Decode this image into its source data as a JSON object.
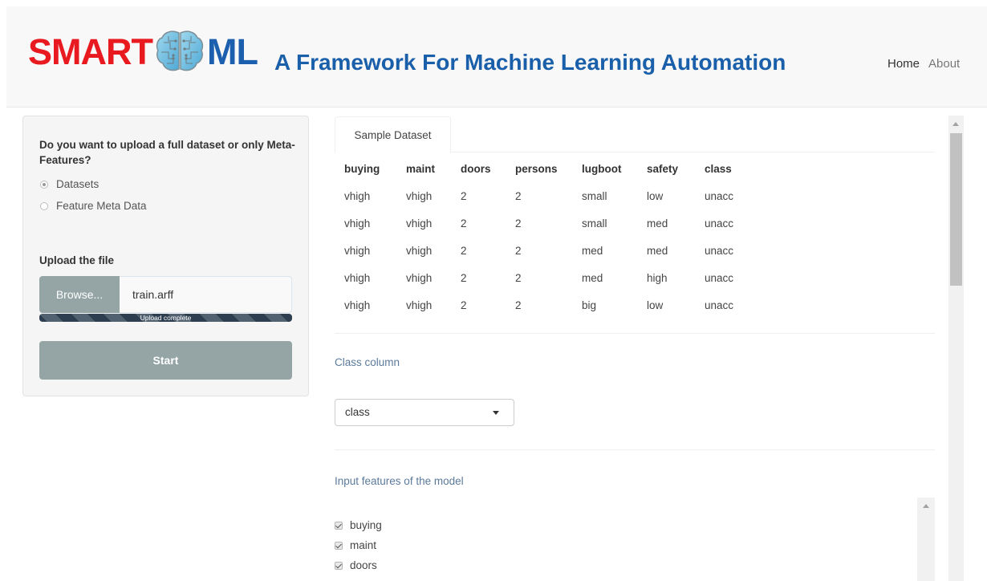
{
  "header": {
    "logo_smart": "SMART",
    "logo_ml": "ML",
    "title": "A Framework For Machine Learning Automation",
    "nav": {
      "home": "Home",
      "about": "About"
    }
  },
  "sidebar": {
    "question": "Do you want to upload a full dataset or only Meta-Features?",
    "options": [
      "Datasets",
      "Feature Meta Data"
    ],
    "selected_option": "Datasets",
    "upload_label": "Upload the file",
    "browse_label": "Browse...",
    "file_name": "train.arff",
    "progress_text": "Upload complete",
    "progress_percent": 100,
    "start_label": "Start"
  },
  "main": {
    "tab": "Sample Dataset",
    "table": {
      "columns": [
        "buying",
        "maint",
        "doors",
        "persons",
        "lugboot",
        "safety",
        "class"
      ],
      "rows": [
        [
          "vhigh",
          "vhigh",
          "2",
          "2",
          "small",
          "low",
          "unacc"
        ],
        [
          "vhigh",
          "vhigh",
          "2",
          "2",
          "small",
          "med",
          "unacc"
        ],
        [
          "vhigh",
          "vhigh",
          "2",
          "2",
          "med",
          "med",
          "unacc"
        ],
        [
          "vhigh",
          "vhigh",
          "2",
          "2",
          "med",
          "high",
          "unacc"
        ],
        [
          "vhigh",
          "vhigh",
          "2",
          "2",
          "big",
          "low",
          "unacc"
        ]
      ]
    },
    "class_column_label": "Class column",
    "class_column_value": "class",
    "features_label": "Input features of the model",
    "features": [
      "buying",
      "maint",
      "doors"
    ]
  },
  "colors": {
    "logo_red": "#e8191f",
    "logo_blue": "#1b5fae",
    "title_blue": "#1a5fa9",
    "button_gray": "#95a5a6",
    "progress_dark": "#2c3e50",
    "section_label_blue": "#5b7a9b"
  },
  "icons": {
    "logo": "brain-icon",
    "select": "caret-down-icon",
    "scroll": "arrow-up-icon"
  }
}
